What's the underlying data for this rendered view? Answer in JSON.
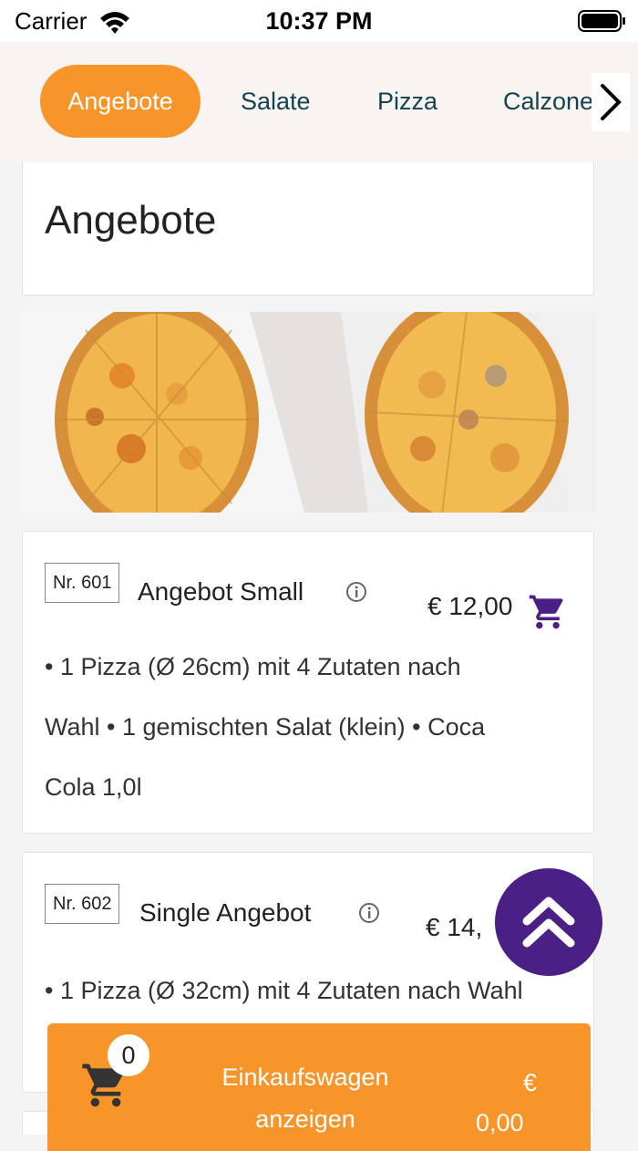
{
  "status": {
    "carrier": "Carrier",
    "time": "10:37 PM"
  },
  "categories": [
    {
      "label": "Angebote",
      "active": true
    },
    {
      "label": "Salate",
      "active": false
    },
    {
      "label": "Pizza",
      "active": false
    },
    {
      "label": "Calzone",
      "active": false
    }
  ],
  "section": {
    "title": "Angebote"
  },
  "items": [
    {
      "nr": "Nr. 601",
      "name": "Angebot Small",
      "price": "€ 12,00",
      "desc_lines": [
        "• 1 Pizza (Ø 26cm) mit 4 Zutaten nach",
        "Wahl • 1 gemischten Salat (klein) • Coca",
        "Cola 1,0l"
      ]
    },
    {
      "nr": "Nr. 602",
      "name": "Single Angebot",
      "price": "€ 14,",
      "desc_lines": [
        "• 1 Pizza (Ø 32cm) mit 4 Zutaten nach Wahl"
      ]
    }
  ],
  "cart": {
    "count": "0",
    "label_line1": "Einkaufswagen",
    "label_line2": "anzeigen",
    "currency": "€",
    "total": "0,00"
  },
  "colors": {
    "accent": "#f7952a",
    "primary": "#4a1f86",
    "nav_text": "#17424f"
  }
}
